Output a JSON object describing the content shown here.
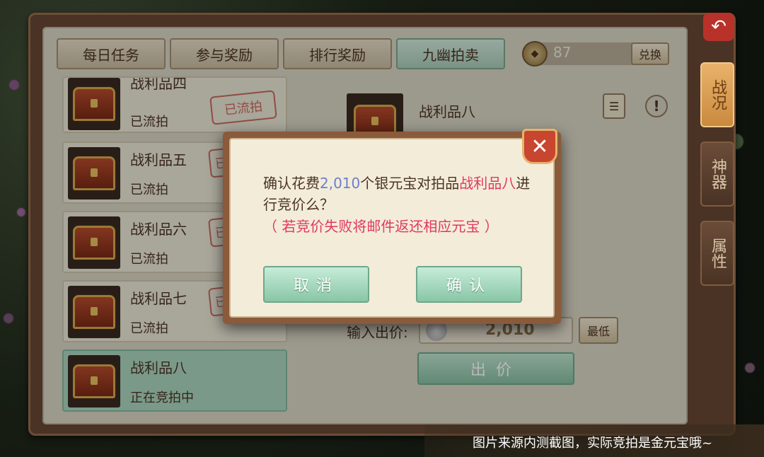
{
  "tabs": [
    {
      "label": "每日任务"
    },
    {
      "label": "参与奖励"
    },
    {
      "label": "排行奖励"
    },
    {
      "label": "九幽拍卖"
    }
  ],
  "currency": {
    "amount": "87",
    "exchange_label": "兑换",
    "icon": "silver-ingot-icon"
  },
  "side_tabs": [
    {
      "label": "战况"
    },
    {
      "label": "神器"
    },
    {
      "label": "属性"
    }
  ],
  "back_icon": "back-arrow-icon",
  "list": [
    {
      "name": "战利品四",
      "status": "已流拍",
      "stamp": "已流拍"
    },
    {
      "name": "战利品五",
      "status": "已流拍",
      "stamp": "已"
    },
    {
      "name": "战利品六",
      "status": "已流拍",
      "stamp": "已"
    },
    {
      "name": "战利品七",
      "status": "已流拍",
      "stamp": "已"
    },
    {
      "name": "战利品八",
      "status": "正在竞拍中"
    }
  ],
  "detail": {
    "title": "战利品八",
    "bid_label": "输入出价:",
    "bid_value": "2,010",
    "min_label": "最低",
    "place_bid_label": "出价"
  },
  "modal": {
    "text_prefix": "确认花费",
    "amount": "2,010",
    "text_mid": "个银元宝对拍品",
    "item_name": "战利品八",
    "text_suffix": "进行竞价么？",
    "note": "（ 若竞价失败将邮件返还相应元宝 ）",
    "cancel_label": "取消",
    "confirm_label": "确认",
    "close_icon": "close-icon"
  },
  "caption": "图片来源内测截图，实际竞拍是金元宝哦~",
  "colors": {
    "accent_pink": "#e03860",
    "accent_blue": "#6c7fd0",
    "active_tab": "#a9cdb9"
  }
}
